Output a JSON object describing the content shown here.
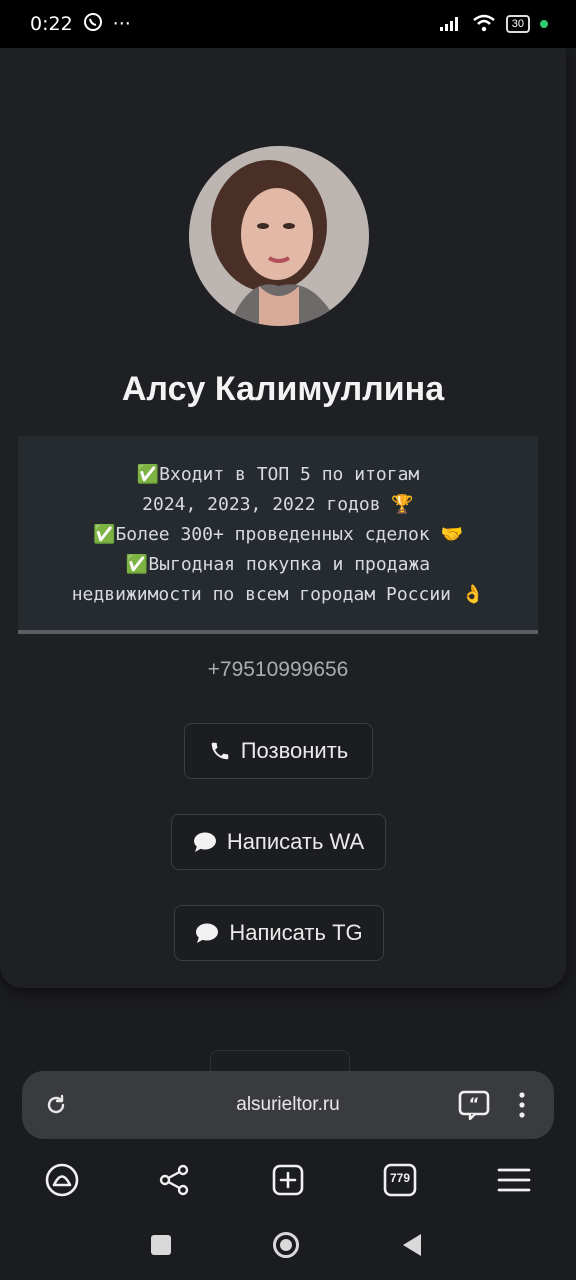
{
  "status": {
    "time": "0:22",
    "dots": "···",
    "battery": "30"
  },
  "profile": {
    "name": "Алсу Калимуллина",
    "bio_lines": [
      "✅Входит в ТОП 5 по итогам",
      "2024, 2023, 2022 годов 🏆",
      "✅Более 300+ проведенных сделок 🤝",
      "✅Выгодная покупка и продажа",
      "недвижимости по всем городам России 👌"
    ],
    "phone": "+79510999656"
  },
  "buttons": {
    "call": "Позвонить",
    "wa": "Написать WA",
    "tg": "Написать TG"
  },
  "browser": {
    "url": "alsurieltor.ru",
    "tabs_count": "779"
  }
}
